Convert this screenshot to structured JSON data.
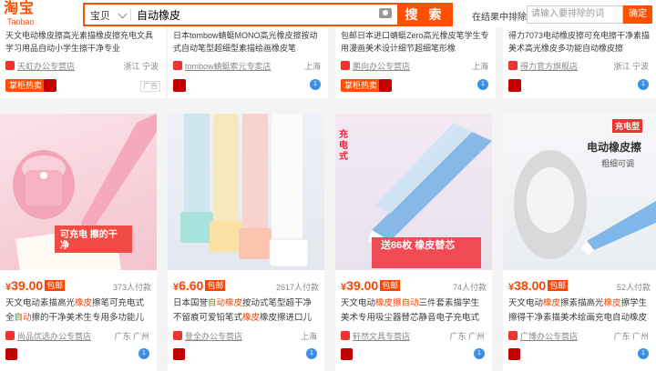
{
  "header": {
    "logo_cn": "淘宝",
    "logo_en": "Taobao",
    "scope": "宝贝",
    "query": "自动橡皮",
    "search_button": "搜 索",
    "within_label": "在结果中排除",
    "within_placeholder": "请输入要排除的词",
    "within_button": "确定"
  },
  "top_row": [
    {
      "title": "天文电动橡皮擦高光素描橡皮擦充电文具学习用品自动小学生擦干净专业",
      "shop": "天虹办公专营店",
      "location": "浙江 宁波",
      "badge": "掌柜热卖",
      "ad": "广告"
    },
    {
      "title": "日本tombow蜻蜓MONO高光橡皮擦按动式自动笔型超细型素描绘画橡皮笔",
      "shop": "tombow蜻蜓索元专卖店",
      "location": "上海"
    },
    {
      "title": "包邮日本进口蜻蜓Zero高光橡皮笔学生专用漫画美术设计细节超细笔形橡",
      "shop": "鹏向办公专营店",
      "location": "上海",
      "badge": "掌柜热卖"
    },
    {
      "title": "得力7073电动橡皮擦可充电擦干净素描美术高光橡皮多功能自动橡皮擦",
      "shop": "得力官方旗舰店",
      "location": "浙江 宁波"
    }
  ],
  "products": [
    {
      "price": "39.00",
      "baoyou": "包邮",
      "sales": "373人付款",
      "title_pre": "天文电动素描高光",
      "title_hl": "橡皮",
      "title_mid": "擦笔可充电式全",
      "title_hl2": "自动",
      "title_post": "擦的干净美术生专用多功能儿",
      "shop": "尚品优选办公专营店",
      "location": "广东 广州",
      "img_caption": "可充电 擦的干净"
    },
    {
      "price": "6.60",
      "baoyou": "包邮",
      "sales": "2617人付款",
      "title_pre": "日本国誉",
      "title_hl": "自动橡皮",
      "title_mid": "按动式笔型超干净不留痕可爱铅笔式",
      "title_hl2": "橡皮",
      "title_post": "橡皮擦进口儿童",
      "shop": "登全办公专营店",
      "location": "上海",
      "img_caption": ""
    },
    {
      "price": "39.00",
      "baoyou": "包邮",
      "sales": "74人付款",
      "title_pre": "天文电动",
      "title_hl": "橡皮擦",
      "title_mid": "",
      "title_hl2": "自动",
      "title_post": "三件套素描学生美术专用吸尘器替芯静音电子充电式",
      "shop": "轩然文具专营店",
      "location": "广东 广州",
      "img_caption": "送86枚 橡皮替芯"
    },
    {
      "price": "38.00",
      "baoyou": "包邮",
      "sales": "52人付款",
      "title_pre": "天文电动",
      "title_hl": "橡皮",
      "title_mid": "擦素描高光",
      "title_hl2": "橡皮",
      "title_post": "擦学生擦得干净素描美术绘画充电自动橡皮创",
      "shop": "广博办公专营店",
      "location": "广东 广州",
      "img_caption": "电动橡皮擦",
      "img_sub": "粗细可调",
      "img_tag": "充电型"
    }
  ]
}
